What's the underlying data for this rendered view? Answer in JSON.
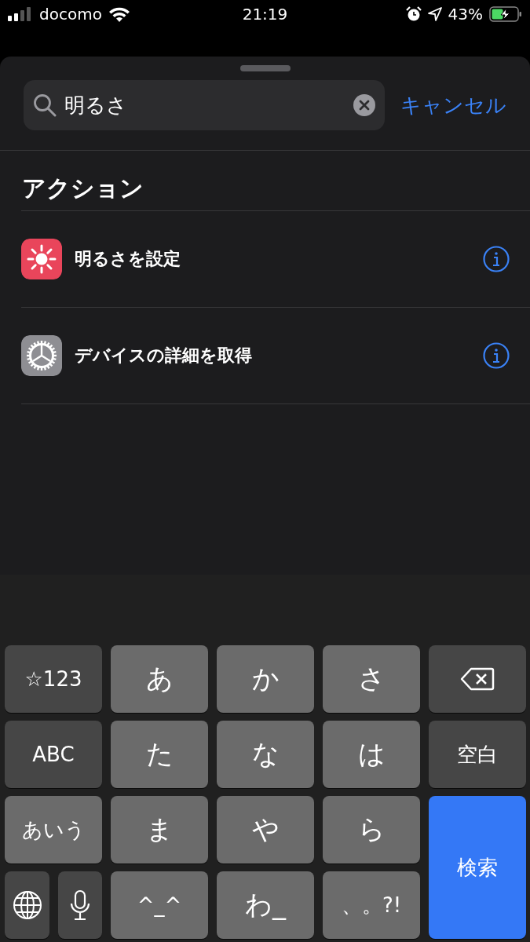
{
  "status_bar": {
    "carrier": "docomo",
    "time": "21:19",
    "battery_text": "43%"
  },
  "search": {
    "value": "明るさ",
    "cancel": "キャンセル"
  },
  "section_title": "アクション",
  "actions": [
    {
      "title": "明るさを設定",
      "kind": "brightness"
    },
    {
      "title": "デバイスの詳細を取得",
      "kind": "settings"
    }
  ],
  "keyboard": {
    "keys": [
      {
        "kind": "mode",
        "label": "☆123",
        "selected": false
      },
      {
        "kind": "kana",
        "label": "あ"
      },
      {
        "kind": "kana",
        "label": "か"
      },
      {
        "kind": "kana",
        "label": "さ"
      },
      {
        "kind": "backspace"
      },
      {
        "kind": "mode",
        "label": "ABC",
        "selected": false
      },
      {
        "kind": "kana",
        "label": "た"
      },
      {
        "kind": "kana",
        "label": "な"
      },
      {
        "kind": "kana",
        "label": "は"
      },
      {
        "kind": "function",
        "label": "空白"
      },
      {
        "kind": "mode",
        "label": "あいう",
        "selected": true
      },
      {
        "kind": "kana",
        "label": "ま"
      },
      {
        "kind": "kana",
        "label": "や"
      },
      {
        "kind": "kana",
        "label": "ら"
      },
      {
        "kind": "search",
        "label": "検索"
      },
      {
        "kind": "globe"
      },
      {
        "kind": "mic"
      },
      {
        "kind": "kana",
        "label": "^_^"
      },
      {
        "kind": "kana",
        "label": "わ_"
      },
      {
        "kind": "kana",
        "label": "、。?!"
      }
    ]
  }
}
